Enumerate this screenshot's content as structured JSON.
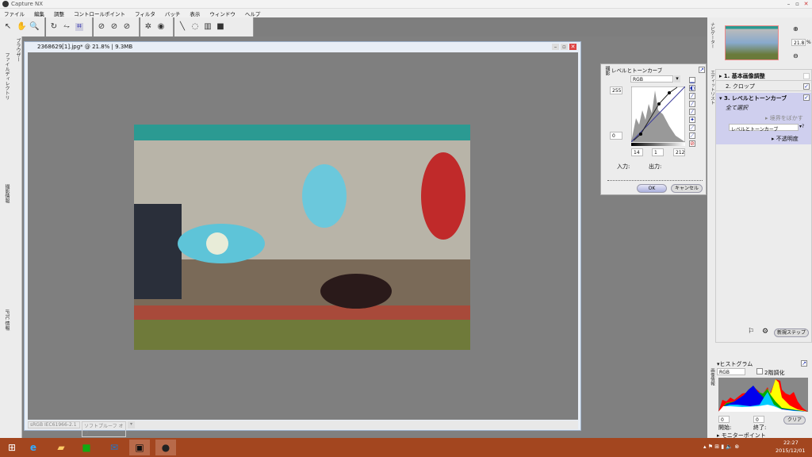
{
  "app": {
    "title": "Capture NX"
  },
  "menu": [
    "ファイル",
    "編集",
    "調整",
    "コントロールポイント",
    "フィルタ",
    "バッチ",
    "表示",
    "ウィンドウ",
    "ヘルプ"
  ],
  "left_tabs": [
    "ブラウザー",
    "ファイルディレクトリ",
    "撮影情報",
    "IPTC 情報"
  ],
  "document": {
    "title": "2368629[1].jpg* @ 21.8% | 9.3MB",
    "color_profile": "sRGB IEC61966-2.1",
    "softproof": "ソフトプルーフ オフ"
  },
  "levels": {
    "title": "レベルとトーンカーブ",
    "side_label": "撮影",
    "channel": "RGB",
    "output_max": "255",
    "output_min": "0",
    "input_black": "14",
    "gamma": "1",
    "input_white": "212",
    "input_label": "入力:",
    "output_label": "出力:",
    "ok": "OK",
    "cancel": "キャンセル"
  },
  "navigator": {
    "tab": "ナビゲーター",
    "zoom": "21.8",
    "unit": "%"
  },
  "edit_list": {
    "tab": "エディットリスト",
    "steps": [
      {
        "label": "1. 基本画像調整",
        "checked": false
      },
      {
        "label": "2. クロップ",
        "checked": true
      },
      {
        "label": "3. レベルとトーンカーブ",
        "checked": true
      }
    ],
    "select_all": "全て選択",
    "blend": "境界をぼかす",
    "filter": "レベルとトーンカーブ",
    "opacity": "不透明度",
    "new_step": "新規ステップ"
  },
  "histogram": {
    "tab": "画像情報",
    "title": "ヒストグラム",
    "channel": "RGB",
    "checkbox": "2階調化",
    "start": "0",
    "end": "0",
    "start_label": "開始:",
    "end_label": "終了:",
    "clear": "クリア",
    "monitor": "モニターポイント"
  },
  "taskbar": {
    "time": "22:27",
    "date": "2015/12/01"
  },
  "colors": {
    "taskbar": "#a3461f",
    "highlight": "#cfcfee",
    "canvas": "#7f7f7f"
  }
}
